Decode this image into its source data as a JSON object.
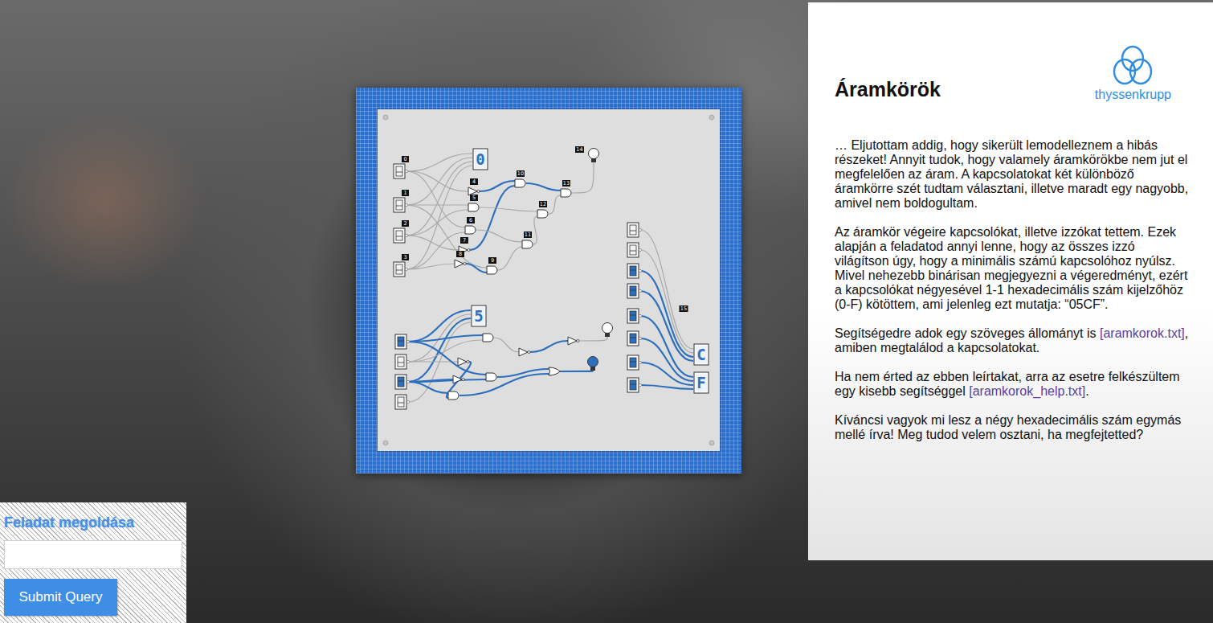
{
  "panel": {
    "title": "Áramkörök",
    "logo": "thyssenkrupp",
    "paragraphs": [
      [
        {
          "text": "… Eljutottam addig, hogy sikerült lemodelleznem a hibás részeket! Annyit tudok, hogy valamely áramkörökbe nem jut el megfelelően az áram. A kapcsolatokat két különböző áramkörre szét tudtam választani, illetve maradt egy nagyobb, amivel nem boldogultam.",
          "link": false
        }
      ],
      [
        {
          "text": "Az áramkör végeire kapcsolókat, illetve izzókat tettem. Ezek alapján a feladatod annyi lenne, hogy az összes izzó világítson úgy, hogy a minimális számú kapcsolóhoz nyúlsz. Mivel nehezebb binárisan megjegyezni a végeredményt, ezért a kapcsolókat négyesével 1-1 hexadecimális szám kijelzőhöz (0-F) kötöttem, ami jelenleg ezt mutatja: “05CF”.",
          "link": false
        }
      ],
      [
        {
          "text": "Segítségedre adok egy szöveges állományt is ",
          "link": false
        },
        {
          "text": "[aramkorok.txt]",
          "link": true
        },
        {
          "text": ", amiben megtalálod a kapcsolatokat.",
          "link": false
        }
      ],
      [
        {
          "text": "Ha nem érted az ebben leírtakat, arra az esetre felkészültem egy kisebb segítséggel ",
          "link": false
        },
        {
          "text": "[aramkorok_help.txt]",
          "link": true
        },
        {
          "text": ".",
          "link": false
        }
      ],
      [
        {
          "text": "Kíváncsi vagyok mi lesz a négy hexadecimális szám egymás mellé írva! Meg tudod velem osztani, ha megfejtetted?",
          "link": false
        }
      ]
    ]
  },
  "form": {
    "title": "Feladat megoldása",
    "value": "",
    "button": "Submit Query"
  },
  "circuits": [
    {
      "switches": [
        {
          "label": "0",
          "on": false
        },
        {
          "label": "1",
          "on": false
        },
        {
          "label": "2",
          "on": false
        },
        {
          "label": "3",
          "on": false
        }
      ],
      "displays": [
        {
          "digit": "0"
        }
      ],
      "gates": [
        {
          "label": "4",
          "kind": "not",
          "powered": true
        },
        {
          "label": "5",
          "kind": "and",
          "powered": false
        },
        {
          "label": "6",
          "kind": "and",
          "powered": false
        },
        {
          "label": "7",
          "kind": "not",
          "powered": true
        },
        {
          "label": "8",
          "kind": "not",
          "powered": true
        },
        {
          "label": "9",
          "kind": "and",
          "powered": false
        },
        {
          "label": "10",
          "kind": "and",
          "powered": true
        },
        {
          "label": "11",
          "kind": "and",
          "powered": false
        },
        {
          "label": "12",
          "kind": "and",
          "powered": false
        },
        {
          "label": "13",
          "kind": "and",
          "powered": false
        }
      ],
      "bulbs": [
        {
          "label": "14",
          "lit": false
        }
      ],
      "tags": []
    },
    {
      "switches": [
        {
          "on": true
        },
        {
          "on": false
        },
        {
          "on": true
        },
        {
          "on": false
        }
      ],
      "displays": [
        {
          "digit": "5"
        }
      ],
      "gates": [
        {
          "kind": "and",
          "powered": false
        },
        {
          "kind": "not",
          "powered": true
        },
        {
          "kind": "not",
          "powered": true
        },
        {
          "kind": "not",
          "powered": false
        },
        {
          "kind": "and",
          "powered": true
        },
        {
          "kind": "or",
          "powered": true
        },
        {
          "kind": "and",
          "powered": true
        },
        {
          "kind": "not",
          "powered": false
        }
      ],
      "bulbs": [
        {
          "lit": false
        },
        {
          "lit": true
        }
      ],
      "tags": []
    },
    {
      "switches": [
        {
          "on": false
        },
        {
          "on": false
        },
        {
          "on": true
        },
        {
          "on": true
        },
        {
          "on": true
        },
        {
          "on": true
        },
        {
          "on": true
        },
        {
          "on": true
        }
      ],
      "displays": [
        {
          "digit": "C"
        },
        {
          "digit": "F"
        }
      ],
      "gates": [],
      "bulbs": [],
      "tags": [
        "15"
      ]
    }
  ]
}
